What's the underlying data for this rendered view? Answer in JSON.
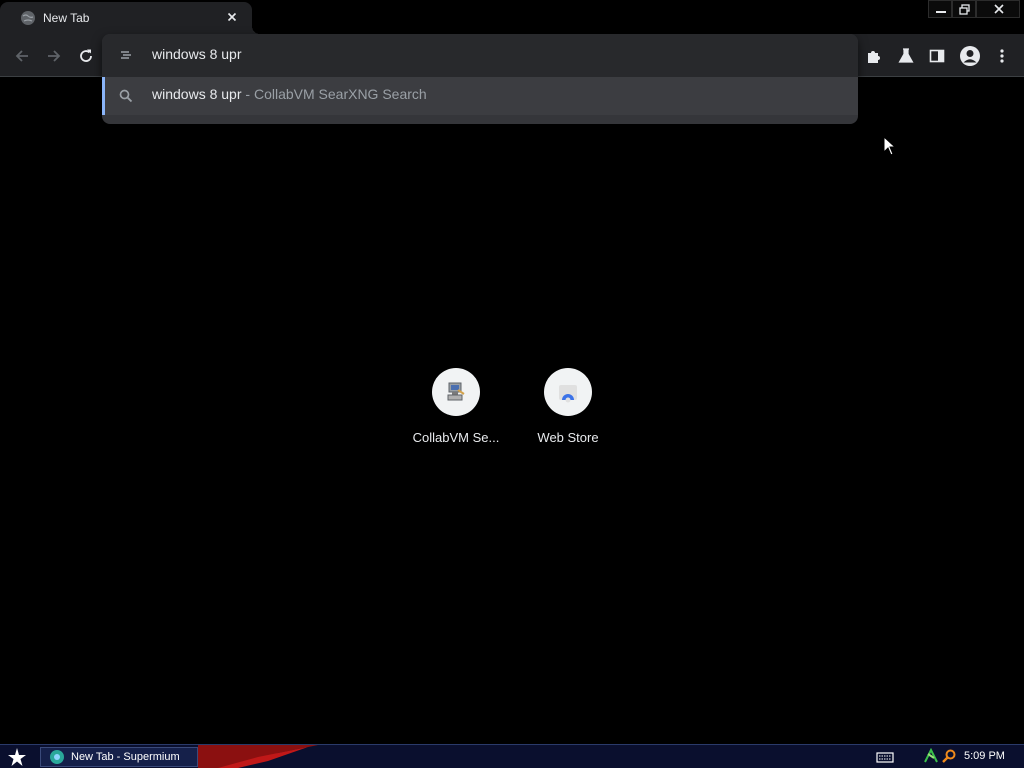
{
  "browser": {
    "tab": {
      "title": "New Tab"
    },
    "omnibox": {
      "input_value": "windows 8 upr",
      "suggestion": {
        "query": "windows 8 upr",
        "separator": " - ",
        "engine": "CollabVM SearXNG Search"
      }
    },
    "shortcuts": [
      {
        "label": "CollabVM Se...",
        "icon": "collabvm-icon"
      },
      {
        "label": "Web Store",
        "icon": "web-store-icon"
      }
    ],
    "accent_color": "#8ab4f8"
  },
  "taskbar": {
    "window_button": {
      "label": "New Tab - Supermium"
    },
    "clock": "5:09 PM"
  }
}
